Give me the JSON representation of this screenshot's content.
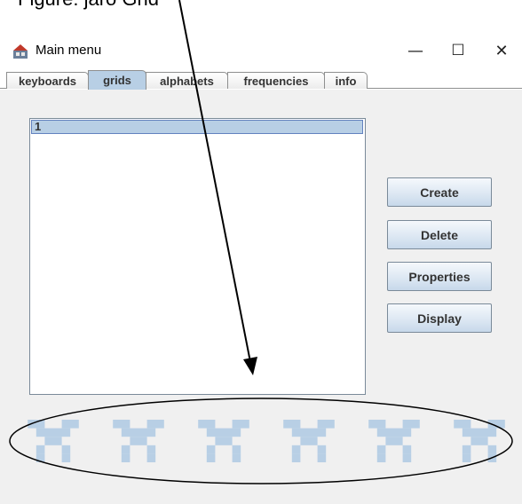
{
  "caption": "Figure: jaro Grid",
  "window": {
    "title": "Main menu",
    "minimize_glyph": "—",
    "maximize_glyph": "☐",
    "close_glyph": "✕"
  },
  "tabs": [
    {
      "label": "keyboards",
      "active": false
    },
    {
      "label": "grids",
      "active": true
    },
    {
      "label": "alphabets",
      "active": false
    },
    {
      "label": "frequencies",
      "active": false
    },
    {
      "label": "info",
      "active": false
    }
  ],
  "grid_list": {
    "items": [
      "1"
    ],
    "selected": "1"
  },
  "buttons": {
    "create": "Create",
    "delete": "Delete",
    "properties": "Properties",
    "display": "Display"
  },
  "decoration": {
    "icon": "grid-x-pattern-icon",
    "color": "#b8cfe5",
    "count": 6
  },
  "colors": {
    "selection": "#b8cfe5",
    "panel_bg": "#f0f0f0",
    "annotation": "#000000"
  }
}
